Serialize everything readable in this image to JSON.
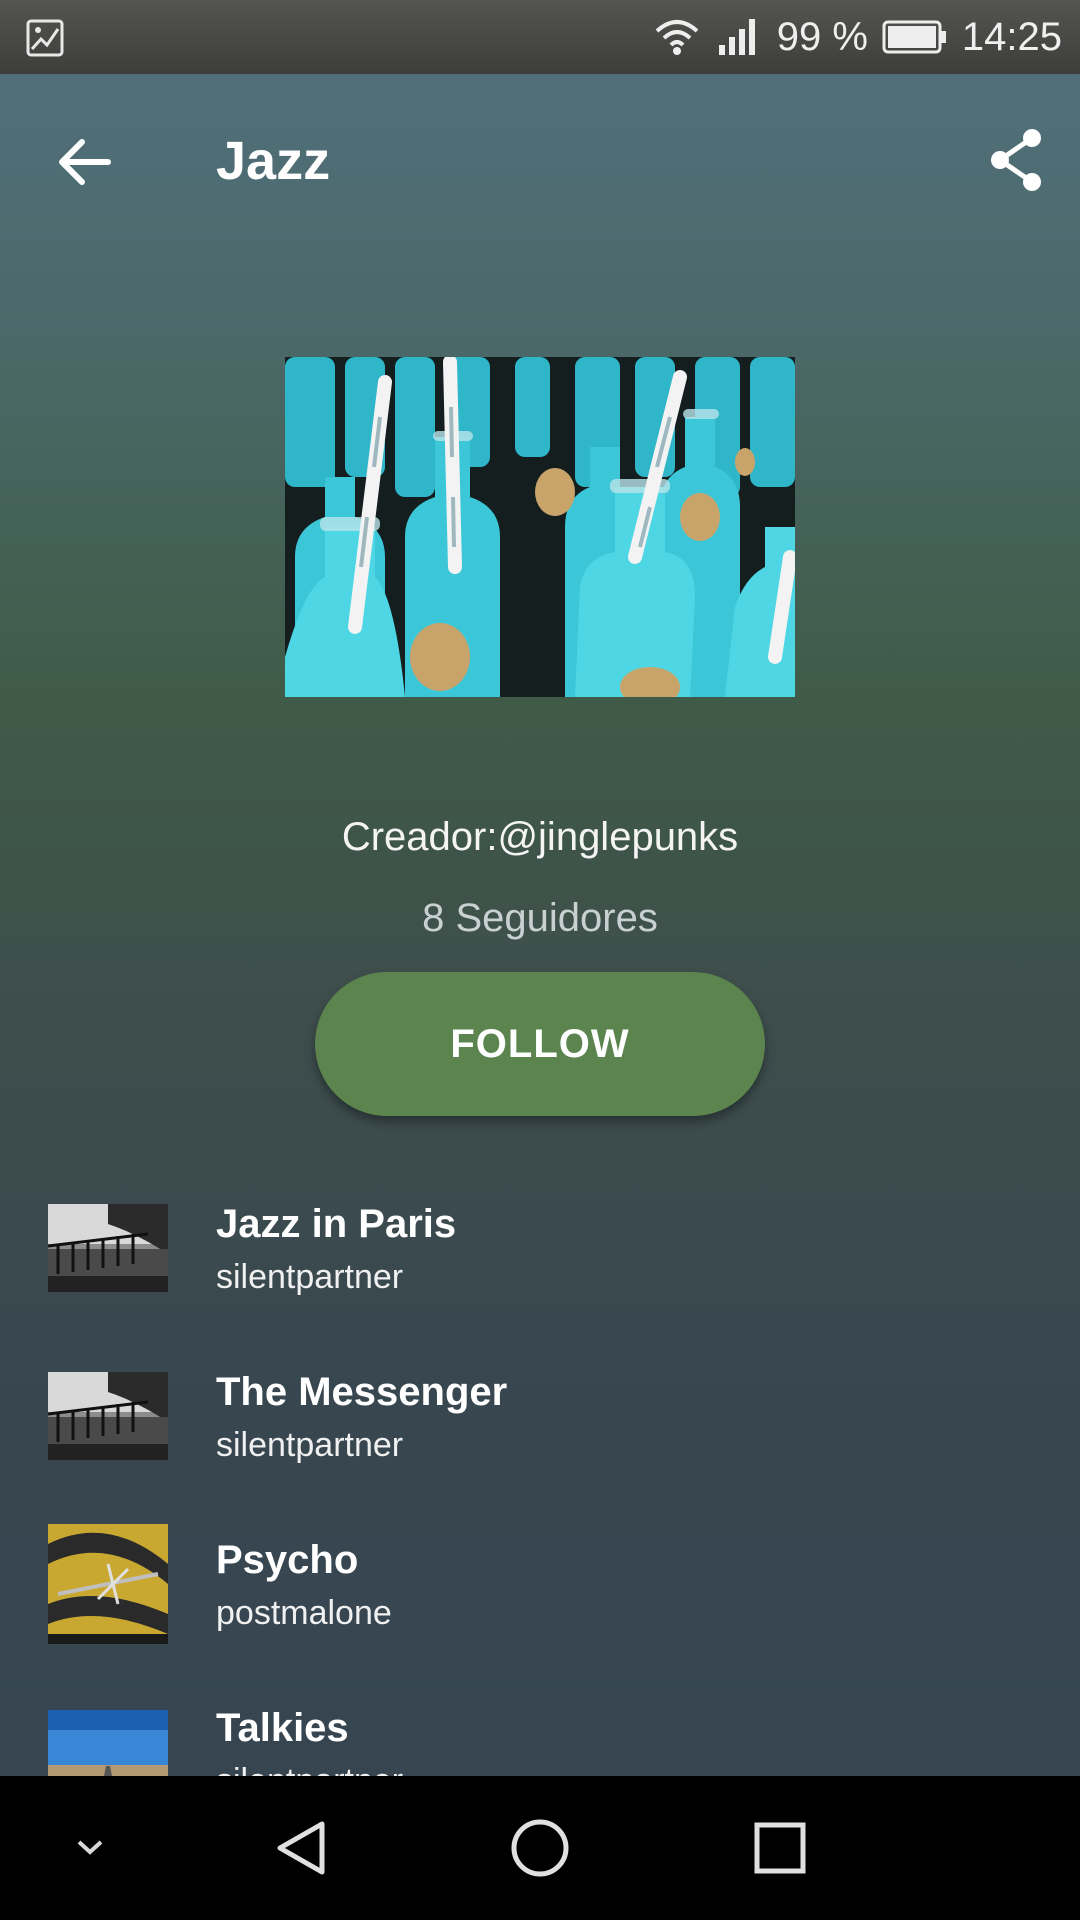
{
  "status_bar": {
    "battery_percent": "99 %",
    "time": "14:25",
    "icons": [
      "gallery-icon",
      "wifi-icon",
      "signal-icon",
      "battery-icon"
    ]
  },
  "app_bar": {
    "title": "Jazz",
    "back_icon": "arrow-back-icon",
    "share_icon": "share-icon"
  },
  "playlist": {
    "creator": "Creador:@jinglepunks",
    "followers": "8 Seguidores",
    "follow_label": "FOLLOW"
  },
  "tracks": [
    {
      "title": "Jazz in Paris",
      "artist": "silentpartner"
    },
    {
      "title": "The Messenger",
      "artist": "silentpartner"
    },
    {
      "title": "Psycho",
      "artist": "postmalone"
    },
    {
      "title": "Talkies",
      "artist": "silentpartner"
    }
  ],
  "nav_bar": {
    "icons": [
      "chevron-down-icon",
      "back-triangle-icon",
      "home-circle-icon",
      "recents-square-icon"
    ]
  },
  "colors": {
    "accent": "#5c844f",
    "status_bar": "#474745",
    "nav_bar": "#000000"
  }
}
